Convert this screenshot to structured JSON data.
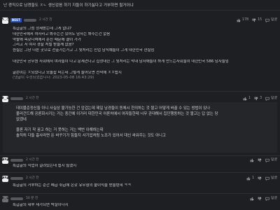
{
  "top_comment": "난 경직으로 남경들도 ㅈㄴ 생신감음 하기 지들이 하기싫다고 거부하면 될거아냐",
  "best_comment": {
    "badge": "BEST",
    "time": "2 시간 전",
    "likes": "178",
    "replies_count": "15",
    "reply_label": "답글",
    "lines": [
      "특급글의 그럼 정제받는데 그게 없냐?",
      "대한민국에서 여자라고 봐주는건 있어도 남자는 봐주는건 없음",
      "약할애 목갖다쳐에서 순진 때문에 결이 가가",
      "그리고 저 여자 경찰 처벌 받을께 없음?",
      "원실은 그냥 다른 곳으로 전출가는거고 그 뒷처리는 신업 남직예들이 그게 대한민국 현실임",
      "",
      "대한민국 공무원 사회에서 여자들이 다고 문제견다고 집정대한 그 뒷처리는 막내 남자애들이 하게 만드는사회들이 대한민국 586 남자들임",
      "",
      "글쓴이는 ㅈ되었다고 모돌잡 떠는데 그렇게 들어오면 전착에 ㅈㅈ밥지",
      "(댓글이 수정되었습니다: 2023-05-08 16:43:29)"
    ]
  },
  "reply_block": {
    "time": "2 시간 전",
    "likes": "1",
    "dislikes": "3",
    "reply_label": "답글",
    "lines": [
      "데이블준정신들 아니 사실상 불가능한 건 압겁는데 제일 남경들이 동체시 한의하는 것 짤고 어떻게 바꿀 수 있는 방법이 있나",
      "불러건드해 공론화시키는 거는 중간예 이거러 대한민국 어론처에서 여자들한테 너무 관대해서 집단행동하는 것 짤고는 답 없는 당",
      "없겠네",
      "",
      "물론 자기 작 꿈고 하는 거 못하는 거는 백번 이해하는데",
      "솔직히 다들 흉사라면 돈 바꾸기가 힘들지 사기업처럼 노조가 있어서 대신 싸워주는 것도 아니고"
    ]
  },
  "comment3": {
    "time": "2 시간 전",
    "likes": "",
    "reply_label": "답글",
    "text": "특급글의 직업이 걸려있는데 쉽지 않겠지"
  },
  "comment4": {
    "time": "2 시간 전",
    "likes": "1",
    "reply_label": "답글",
    "text": "특급글의 거부하는 순간 폐급 취급에 온갖 유무형의 불이익을 받을텐데 ㅋㅋ"
  },
  "comment5": {
    "time": "50 분 전",
    "reply_label": "답글",
    "text": "특급글의 내부 재가되면 박살이나지"
  },
  "colors": {
    "background": "#1e1f22",
    "best_badge": "#2b53c6",
    "reply_bg": "#25262a"
  }
}
